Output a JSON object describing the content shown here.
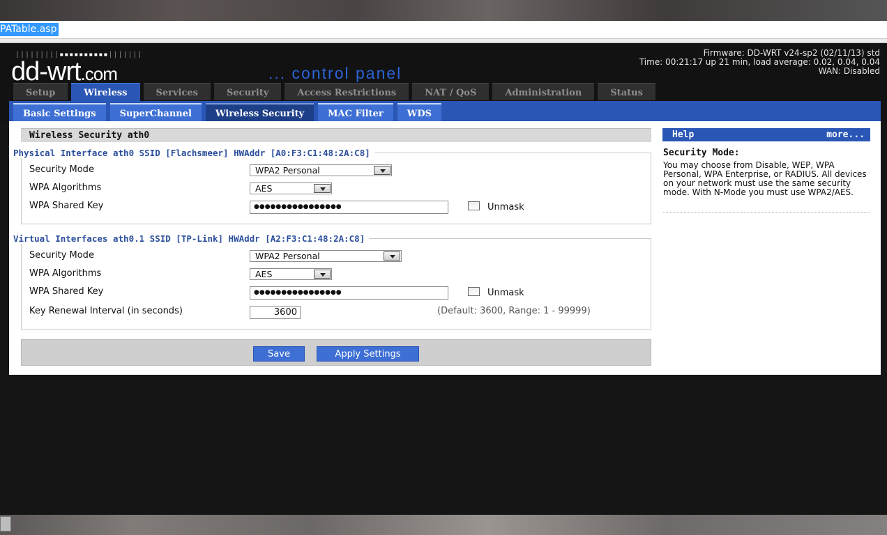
{
  "browser": {
    "url": "PATable.asp"
  },
  "header": {
    "logo_ticks_dim": "|||||||||",
    "logo_ticks_bright": "▪▪▪▪▪▪▪▪▪▪",
    "logo_ticks_tail": "|||||||",
    "logo_main": "dd-wrt",
    "logo_suffix": ".com",
    "tagline": "... control panel",
    "firmware": "Firmware: DD-WRT v24-sp2 (02/11/13) std",
    "time": "Time: 00:21:17 up 21 min, load average: 0.02, 0.04, 0.04",
    "wan": "WAN: Disabled"
  },
  "main_tabs": [
    "Setup",
    "Wireless",
    "Services",
    "Security",
    "Access Restrictions",
    "NAT / QoS",
    "Administration",
    "Status"
  ],
  "sub_tabs": [
    "Basic Settings",
    "SuperChannel",
    "Wireless Security",
    "MAC Filter",
    "WDS"
  ],
  "section_title": "Wireless Security ath0",
  "physical": {
    "legend": "Physical Interface ath0 SSID [Flachsmeer] HWAddr [A0:F3:C1:48:2A:C8]",
    "security_mode_label": "Security Mode",
    "security_mode_value": "WPA2 Personal",
    "algorithms_label": "WPA Algorithms",
    "algorithms_value": "AES",
    "shared_key_label": "WPA Shared Key",
    "shared_key_value": "●●●●●●●●●●●●●●●●",
    "unmask_label": "Unmask"
  },
  "virtual": {
    "legend": "Virtual Interfaces ath0.1 SSID [TP-Link] HWAddr [A2:F3:C1:48:2A:C8]",
    "security_mode_label": "Security Mode",
    "security_mode_value": "WPA2 Personal",
    "algorithms_label": "WPA Algorithms",
    "algorithms_value": "AES",
    "shared_key_label": "WPA Shared Key",
    "shared_key_value": "●●●●●●●●●●●●●●●●",
    "unmask_label": "Unmask",
    "renewal_label": "Key Renewal Interval (in seconds)",
    "renewal_value": "3600",
    "renewal_hint": "(Default: 3600, Range: 1 - 99999)"
  },
  "buttons": {
    "save": "Save",
    "apply": "Apply Settings"
  },
  "help": {
    "header": "Help",
    "more": "more...",
    "title": "Security Mode:",
    "text": "You may choose from Disable, WEP, WPA Personal, WPA Enterprise, or RADIUS. All devices on your network must use the same security mode. With N-Mode you must use WPA2/AES."
  }
}
